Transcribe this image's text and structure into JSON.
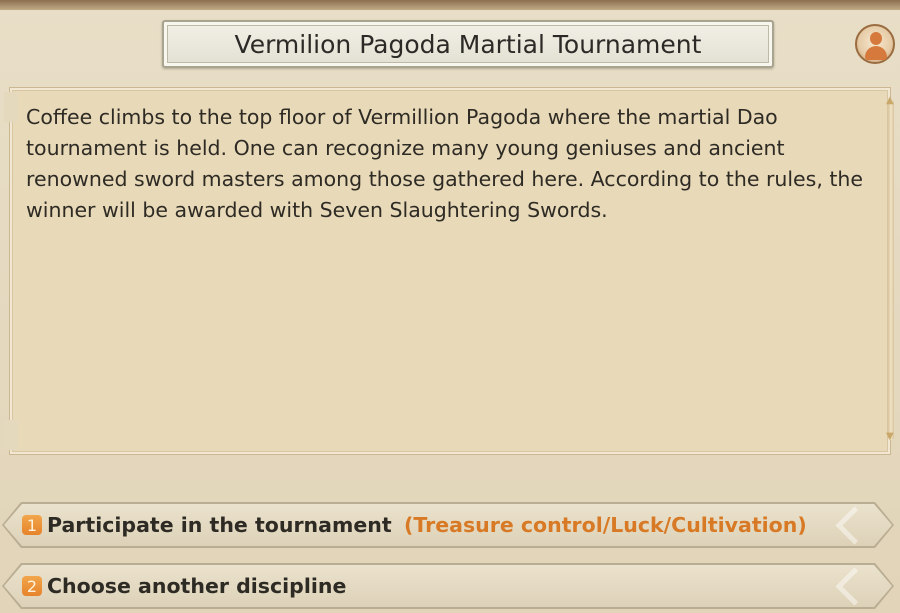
{
  "dialog": {
    "title": "Vermilion Pagoda Martial Tournament",
    "description": "Coffee climbs to the top floor of Vermillion Pagoda where the martial Dao tournament is held. One can recognize many young geniuses and ancient renowned sword masters among those gathered here. According to the rules, the winner will be awarded with Seven Slaughtering Swords."
  },
  "avatar": {
    "icon": "person-icon"
  },
  "options": [
    {
      "number": "1",
      "label": "Participate in the tournament",
      "requirement": "(Treasure control/Luck/Cultivation)"
    },
    {
      "number": "2",
      "label": "Choose another discipline",
      "requirement": ""
    }
  ],
  "colors": {
    "accent": "#d87a25",
    "text": "#2e2b25",
    "badge": "#ef9a42"
  }
}
